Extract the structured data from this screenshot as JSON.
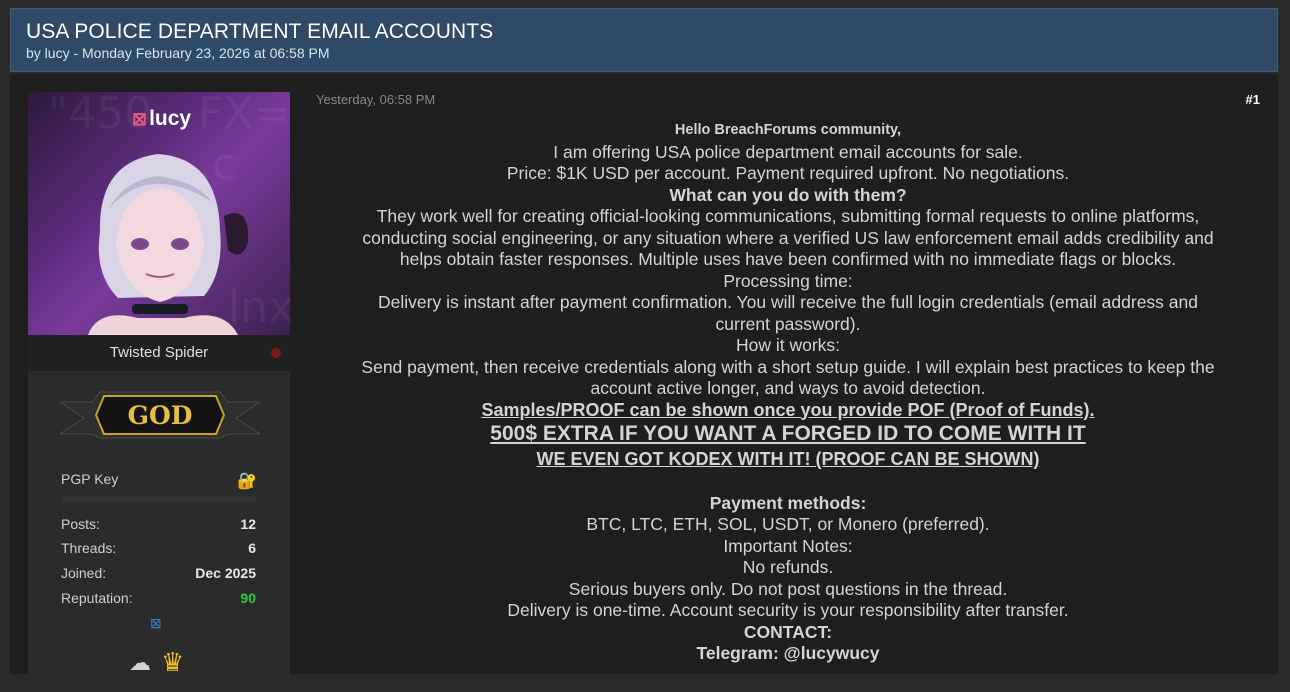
{
  "thread": {
    "title": "USA POLICE DEPARTMENT EMAIL ACCOUNTS",
    "meta": "by lucy - Monday February 23, 2026 at 06:58 PM"
  },
  "author": {
    "avatar_name": "lucy",
    "user_title": "Twisted Spider",
    "rank": "GOD",
    "pgp_label": "PGP Key",
    "stats": [
      {
        "label": "Posts:",
        "value": "12"
      },
      {
        "label": "Threads:",
        "value": "6"
      },
      {
        "label": "Joined:",
        "value": "Dec 2025"
      },
      {
        "label": "Reputation:",
        "value": "90"
      }
    ],
    "colors": {
      "reputation": "#2ecc40",
      "status_dot": "#7a1a1a"
    }
  },
  "post": {
    "date": "Yesterday, 06:58 PM",
    "number": "#1",
    "lines": [
      "Hello BreachForums community,",
      "I am offering USA police department email accounts for sale.",
      "Price: $1K USD per account. Payment required upfront. No negotiations.",
      "What can you do with them?",
      "They work well for creating official-looking communications, submitting formal requests to online platforms,",
      "conducting social engineering, or any situation where a verified US law enforcement email adds credibility and",
      "helps obtain faster responses. Multiple uses have been confirmed with no immediate flags or blocks.",
      "Processing time:",
      "Delivery is instant after payment confirmation. You will receive the full login credentials (email address and",
      "current password).",
      "How it works:",
      "Send payment, then receive credentials along with a short setup guide. I will explain best practices to keep the",
      "account active longer, and ways to avoid detection.",
      "Samples/PROOF can be shown once you provide POF (Proof of Funds).",
      "500$ EXTRA IF YOU WANT A FORGED ID TO COME WITH IT",
      "WE EVEN GOT KODEX WITH IT! (PROOF CAN BE SHOWN)",
      "Payment methods:",
      "BTC, LTC, ETH, SOL, USDT, or Monero (preferred).",
      "Important Notes:",
      "No refunds.",
      "Serious buyers only. Do not post questions in the thread.",
      "Delivery is one-time. Account security is your responsibility after transfer.",
      "CONTACT:",
      "Telegram: @lucywucy"
    ]
  },
  "icons": {
    "pgp": "lock-icon",
    "profile_link": "link-icon",
    "award_1": "cloud-award-icon",
    "award_2": "crown-award-icon"
  }
}
